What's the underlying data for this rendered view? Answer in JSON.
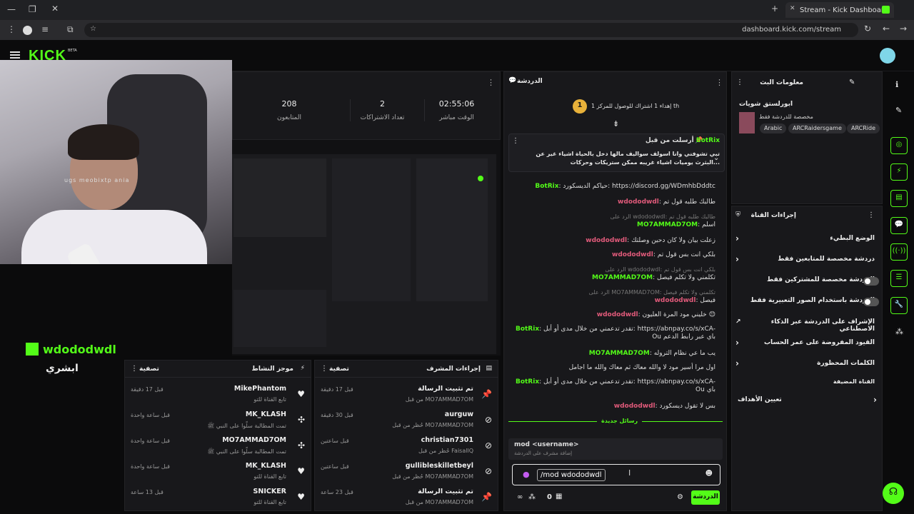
{
  "browser": {
    "tab_title": "Stream - Kick Dashboard",
    "url": "dashboard.kick.com/stream"
  },
  "app": {
    "logo": "KICK",
    "logo_badge": "BETA"
  },
  "webcam": {
    "overlay_text": "ugs meobixtp ania"
  },
  "stats": [
    {
      "value": "02:55:06",
      "label": "الوقت مباشر"
    },
    {
      "value": "2",
      "label": "تعداد الاشتراكات"
    },
    {
      "value": "208",
      "label": "المتابعون"
    }
  ],
  "channel": {
    "name": "wdododwdl",
    "subtitle": "ابشري"
  },
  "activity": {
    "title": "موجز النشاط",
    "filter": "تصفية",
    "items": [
      {
        "name": "MikePhantom",
        "sub": "تابع القناة للتو",
        "time": "قبل 17 دقيقة",
        "icon": "heart-icon"
      },
      {
        "name": "MK_KLASH",
        "sub": "تمت المطالبة سلّوا على النبي ﷺ",
        "time": "قبل ساعة واحدة",
        "icon": "gift-icon"
      },
      {
        "name": "MO7AMMAD7OM",
        "sub": "تمت المطالبة سلّوا على النبي ﷺ",
        "time": "قبل ساعة واحدة",
        "icon": "gift-icon"
      },
      {
        "name": "MK_KLASH",
        "sub": "تابع القناة للتو",
        "time": "قبل ساعة واحدة",
        "icon": "heart-icon"
      },
      {
        "name": "SNICKER",
        "sub": "تابع القناة للتو",
        "time": "قبل 13 ساعة",
        "icon": "heart-icon"
      }
    ]
  },
  "mod_actions": {
    "title": "إجراءات المشرف",
    "filter": "تصفية",
    "items": [
      {
        "name": "تم تثبيت الرسالة",
        "sub": "من قبل MO7AMMAD7OM",
        "time": "قبل 17 دقيقة",
        "icon": "pin-icon"
      },
      {
        "name": "aurguw",
        "sub": "حُظر من قبل MO7AMMAD7OM",
        "time": "قبل 30 دقيقة",
        "icon": "ban-icon"
      },
      {
        "name": "christian7301",
        "sub": "حُظر من قبل FaisallQ",
        "time": "قبل ساعتين",
        "icon": "ban-icon"
      },
      {
        "name": "gullibleskilletbeyl",
        "sub": "حُظر من قبل MO7AMMAD7OM",
        "time": "قبل ساعتين",
        "icon": "ban-icon"
      },
      {
        "name": "تم تثبيت الرسالة",
        "sub": "من قبل MO7AMMAD7OM",
        "time": "قبل 23 ساعة",
        "icon": "pin-icon"
      }
    ]
  },
  "chat": {
    "title": "الدردشة",
    "subs_goal": "إهداء 1 اشتراك للوصول للمركز 1 th",
    "pinned_by": "أرسلت من قبل",
    "pinned_user": "BotRix",
    "pinned_text": "تبي تشوفني وانا اسولف سواليف مالها دخل بالحياة اشياء غير عن البثرث يوميات اشياء غريبه ممكن ستريكات وحركات...",
    "messages": [
      {
        "user": "BotRix",
        "color": "#53fc18",
        "text": "حياكم الديسكورد: https://discord.gg/WDmhbDddtc",
        "reply": ""
      },
      {
        "user": "wdododwdl",
        "color": "#e05a7a",
        "text": "طالبك طلبه قول تم",
        "reply": ""
      },
      {
        "user": "MO7AMMAD7OM",
        "color": "#53fc18",
        "text": "اسلم",
        "reply": "الرد على wdododwdl: طالبك طلبه قول تم"
      },
      {
        "user": "wdododwdl",
        "color": "#e05a7a",
        "text": "زعلت بيان ولا كان دحين وصلتك",
        "reply": ""
      },
      {
        "user": "wdododwdl",
        "color": "#e05a7a",
        "text": "بلكي انت بس قول تم",
        "reply": ""
      },
      {
        "user": "MO7AMMAD7OM",
        "color": "#53fc18",
        "text": "تكلمني ولا تكلم فيصل",
        "reply": "الرد على wdododwdl: بلكي انت بس قول تم"
      },
      {
        "user": "wdododwdl",
        "color": "#e05a7a",
        "text": "فيصل",
        "reply": "الرد على MO7AMMAD7OM: تكلمني ولا تكلم فيصل"
      },
      {
        "user": "wdododwdl",
        "color": "#e05a7a",
        "text": "خليني مود المرة العليون 😊",
        "reply": ""
      },
      {
        "user": "BotRix",
        "color": "#53fc18",
        "text": "تقدر تدعمني من خلال مدى أو أبل: https://abnpay.co/s/xCA-Ou باي عبر رابط الدعم",
        "reply": ""
      },
      {
        "user": "MO7AMMAD7OM",
        "color": "#53fc18",
        "text": "يب ما عي نظام التروله",
        "reply": ""
      },
      {
        "user": "",
        "color": "#ddd",
        "text": "اول مرا أسير مود لا والله معاك ثم معاك والله ما اجامل",
        "reply": ""
      },
      {
        "user": "BotRix",
        "color": "#53fc18",
        "text": "تقدر تدعمني من خلال مدى أو أبل: https://abnpay.co/s/xCA-Ou باي",
        "reply": ""
      },
      {
        "user": "wdododwdl",
        "color": "#e05a7a",
        "text": "بس لا تقول ديسكورد",
        "reply": ""
      }
    ],
    "new_messages": "رسائل جديدة",
    "command_name": "mod <username>",
    "command_desc": "إضافة مشرف على الدردشة",
    "input_value": "/mod wdododwdl",
    "send_label": "الدردشة",
    "counter": "0"
  },
  "stream_info": {
    "title": "معلومات البث",
    "stream_title": "ابورلستق شويات",
    "category": "مخصصة للدردشة فقط",
    "tags": [
      "Arabic",
      "ARCRaidersgame",
      "ARCRide"
    ]
  },
  "channel_actions": {
    "title": "إجراءات القناة",
    "rows": [
      {
        "label": "الوضع البطيء",
        "control": "chevron"
      },
      {
        "label": "دردشة مخصصة للمتابعين فقط",
        "control": "chevron"
      },
      {
        "label": "الدردشة مخصصة للمشتركين فقط",
        "control": "toggle"
      },
      {
        "label": "الدردشة باستخدام الصور التعبيرية فقط",
        "control": "toggle"
      },
      {
        "label": "الإشراف على الدردشة عبر الذكاء الاصطناعي",
        "control": "external"
      },
      {
        "label": "القيود المفروضة على عمر الحساب",
        "control": "chevron"
      },
      {
        "label": "الكلمات المحظورة",
        "control": "chevron"
      }
    ],
    "section2": "القناة المضيفة",
    "target": "تعيين الأهداف"
  },
  "colors": {
    "accent": "#53fc18",
    "panel": "#18181b",
    "bg": "#0b0b0c"
  }
}
